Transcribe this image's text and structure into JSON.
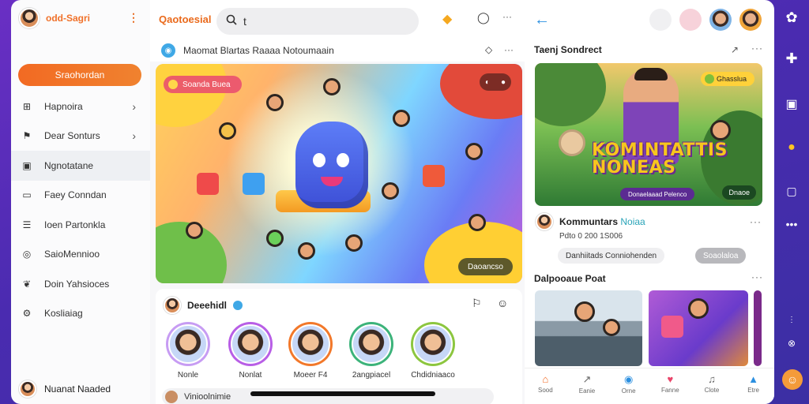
{
  "colors": {
    "accent": "#f26a23",
    "link": "#2b8fe0",
    "verified": "#3fa8e6",
    "rail": "#4a2bb0"
  },
  "sidebar": {
    "brand": "odd-Sagri",
    "primary_button": "Sraohordan",
    "items": [
      {
        "label": "Hapnoira",
        "icon": "grid-icon",
        "chevron": true
      },
      {
        "label": "Dear Sonturs",
        "icon": "flag-icon",
        "chevron": true
      },
      {
        "label": "Ngnotatane",
        "icon": "film-icon",
        "active": true
      },
      {
        "label": "Faey Conndan",
        "icon": "message-icon"
      },
      {
        "label": "Ioen Partonkla",
        "icon": "list-icon"
      },
      {
        "label": "SaioMennioo",
        "icon": "location-icon"
      },
      {
        "label": "Doin Yahsioces",
        "icon": "leaf-icon"
      },
      {
        "label": "Kosliaiag",
        "icon": "settings-icon"
      }
    ],
    "user_name": "Nuanat Naaded"
  },
  "feed": {
    "logo": "Qaotoesial",
    "search_value": "t",
    "subbar_text": "Maomat Blartas Raaaa Notoumaain",
    "hero": {
      "pill": "Soanda Buea",
      "cta": "Daoancso"
    },
    "stories": {
      "header": "Deeehidl",
      "items": [
        {
          "name": "Nonle",
          "ring": "#c79cf3"
        },
        {
          "name": "Nonlat",
          "ring": "#b85ee6"
        },
        {
          "name": "Moeer F4",
          "ring": "#f2782a"
        },
        {
          "name": "2angpiacel",
          "ring": "#3cb37a"
        },
        {
          "name": "Chdidniaaco",
          "ring": "#8cc63f"
        }
      ],
      "compose": "Vinioolnimie"
    }
  },
  "right": {
    "section1": "Taenj Sondrect",
    "feature": {
      "badge": "Ghasslua",
      "title": "KOMINTATTIS NONEAS",
      "tag": "Donaelaaad Pelenco",
      "meta": "Dnaoe"
    },
    "post": {
      "author_a": "Kommuntars",
      "author_b": "Noiaa",
      "stats": "Pdto 0 200 1S006",
      "chip_a": "Danhiitads Conniohenden",
      "chip_b": "Soaolaloa"
    },
    "section2": "Dalpooaue Poat",
    "bottom_nav": [
      {
        "label": "Sood",
        "icon": "home-icon"
      },
      {
        "label": "Eanie",
        "icon": "share-icon"
      },
      {
        "label": "Orne",
        "icon": "globe-icon"
      },
      {
        "label": "Fanne",
        "icon": "heart-icon"
      },
      {
        "label": "Clote",
        "icon": "bell-icon"
      },
      {
        "label": "Etre",
        "icon": "profile-icon"
      }
    ]
  }
}
